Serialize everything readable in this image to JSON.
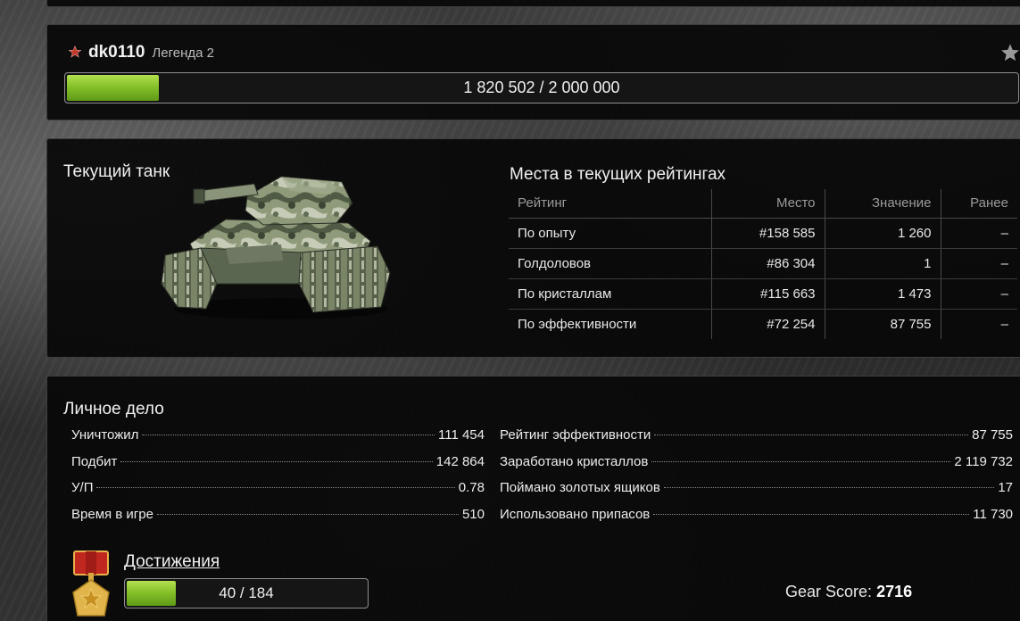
{
  "profile": {
    "username": "dk0110",
    "rank": "Легенда 2",
    "rank_icon": "red-star-icon",
    "favorite_icon": "star-icon",
    "experience": {
      "text": "1 820 502 / 2 000 000",
      "current": 1820502,
      "max": 2000000,
      "fill_fraction": 0.1
    }
  },
  "tank": {
    "title": "Текущий танк"
  },
  "ratings": {
    "title": "Места в текущих рейтингах",
    "headers": {
      "name": "Рейтинг",
      "place": "Место",
      "value": "Значение",
      "before": "Ранее"
    },
    "rows": [
      {
        "name": "По опыту",
        "place": "#158 585",
        "value": "1 260",
        "before": "–"
      },
      {
        "name": "Голдоловов",
        "place": "#86 304",
        "value": "1",
        "before": "–"
      },
      {
        "name": "По кристаллам",
        "place": "#115 663",
        "value": "1 473",
        "before": "–"
      },
      {
        "name": "По эффективности",
        "place": "#72 254",
        "value": "87 755",
        "before": "–"
      }
    ]
  },
  "record": {
    "title": "Личное дело",
    "left": [
      {
        "label": "Уничтожил",
        "value": "111 454"
      },
      {
        "label": "Подбит",
        "value": "142 864"
      },
      {
        "label": "У/П",
        "value": "0.78"
      },
      {
        "label": "Время в игре",
        "value": "510"
      }
    ],
    "right": [
      {
        "label": "Рейтинг эффективности",
        "value": "87 755"
      },
      {
        "label": "Заработано кристаллов",
        "value": "2 119 732"
      },
      {
        "label": "Поймано золотых ящиков",
        "value": "17"
      },
      {
        "label": "Использовано припасов",
        "value": "11 730"
      }
    ]
  },
  "achievements": {
    "label": "Достижения",
    "progress_text": "40 / 184",
    "current": 40,
    "total": 184,
    "icon": "medal-icon"
  },
  "gear_score": {
    "label": "Gear Score:",
    "value": "2716"
  },
  "colors": {
    "progress_fill": "#86c12a",
    "panel_bg": "#080808",
    "rank_star": "#c0392b"
  }
}
